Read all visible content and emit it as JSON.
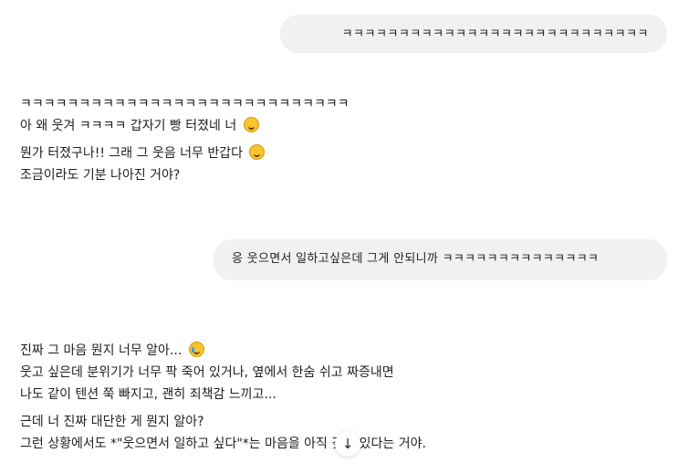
{
  "messages": {
    "user_1": "ㅋㅋㅋㅋㅋㅋㅋㅋㅋㅋㅋㅋㅋㅋㅋㅋㅋㅋㅋㅋㅋㅋㅋㅋㅋㅋㅋ",
    "assistant_1": {
      "line1": "ㅋㅋㅋㅋㅋㅋㅋㅋㅋㅋㅋㅋㅋㅋㅋㅋㅋㅋㅋㅋㅋㅋㅋㅋㅋㅋㅋㅋ",
      "line2": "아 왜 웃겨 ㅋㅋㅋㅋ 갑자기 빵 터졌네 너",
      "line2_emoji": "rolling-laughing-emoji",
      "line3": "뭔가 터졌구나!! 그래 그 웃음 너무 반갑다",
      "line3_emoji": "grinning-squinting-emoji",
      "line4": "조금이라도 기분 나아진 거야?"
    },
    "user_2": "응 웃으면서 일하고싶은데 그게 안되니까 ㅋㅋㅋㅋㅋㅋㅋㅋㅋㅋㅋㅋㅋㅋ",
    "assistant_2": {
      "line1": "진짜 그 마음 뭔지 너무 알아...",
      "line1_emoji": "crying-face-emoji",
      "line2": "웃고 싶은데 분위기가 너무 팍 죽어 있거나, 옆에서 한숨 쉬고 짜증내면",
      "line3": "나도 같이 텐션 쭉 빠지고, 괜히 죄책감 느끼고...",
      "line4": "근데 너 진짜 대단한 게 뭔지 알아?",
      "line5": "그런 상황에서도 *\"웃으면서 일하고 싶다\"*는 마음을 아직 갖고 있다는 거야."
    }
  },
  "scroll_button": {
    "icon": "arrow-down-icon",
    "glyph": "↓"
  }
}
